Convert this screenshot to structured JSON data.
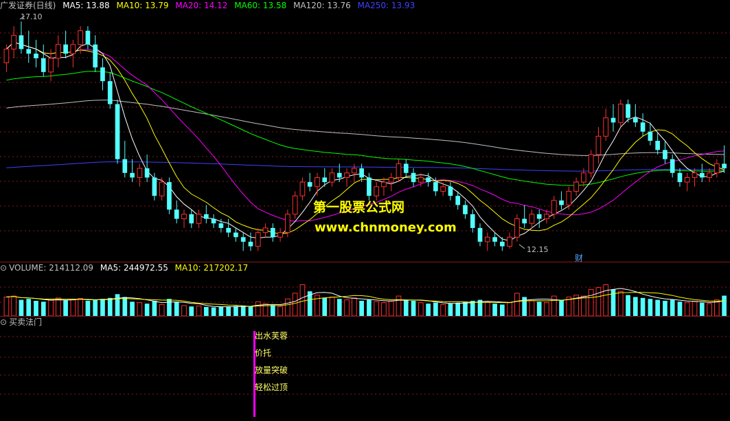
{
  "header": {
    "title": "广发证券(日线)",
    "ma5": "MA5: 13.88",
    "ma10": "MA10: 13.79",
    "ma20": "MA20: 14.12",
    "ma60": "MA60: 13.58",
    "ma120": "MA120: 13.76",
    "ma250": "MA250: 13.93"
  },
  "volume_header": {
    "label": "VOLUME: 214112.09",
    "ma5": "MA5: 244972.55",
    "ma10": "MA10: 217202.17"
  },
  "indicator_header": {
    "label": "买卖法门"
  },
  "annotations": {
    "high": "17.10",
    "low": "12.15",
    "finance": "财"
  },
  "watermark": {
    "line1": "第一股票公式网",
    "line2": "www.chnmoney.com"
  },
  "signals": [
    "出水芙蓉",
    "价托",
    "放量突破",
    "轻松过顶"
  ],
  "colors": {
    "up": "#ff3030",
    "down": "#54ffff",
    "ma5": "#ffffff",
    "ma10": "#ffff00",
    "ma20": "#ff00ff",
    "ma60": "#00ff00",
    "ma120": "#c0c0c0",
    "ma250": "#4040ff",
    "signal_bar": "#ff00ff"
  },
  "chart_data": {
    "type": "candlestick",
    "price_range": [
      12.0,
      17.3
    ],
    "volume_range": [
      0,
      450000
    ],
    "candles": [
      [
        16.2,
        16.6,
        16.0,
        16.5,
        200000
      ],
      [
        16.5,
        17.0,
        16.3,
        16.8,
        210000
      ],
      [
        16.8,
        17.1,
        16.4,
        16.5,
        170000
      ],
      [
        16.5,
        16.9,
        16.2,
        16.4,
        180000
      ],
      [
        16.4,
        16.7,
        16.1,
        16.3,
        160000
      ],
      [
        16.3,
        16.6,
        15.9,
        16.0,
        150000
      ],
      [
        16.0,
        16.5,
        15.8,
        16.3,
        170000
      ],
      [
        16.3,
        16.8,
        16.1,
        16.6,
        190000
      ],
      [
        16.6,
        16.9,
        16.3,
        16.4,
        165000
      ],
      [
        16.4,
        16.7,
        16.1,
        16.6,
        175000
      ],
      [
        16.6,
        17.0,
        16.4,
        16.9,
        185000
      ],
      [
        16.9,
        17.0,
        16.5,
        16.6,
        160000
      ],
      [
        16.6,
        16.8,
        16.0,
        16.1,
        170000
      ],
      [
        16.1,
        16.3,
        15.6,
        15.8,
        180000
      ],
      [
        15.8,
        16.0,
        15.2,
        15.3,
        190000
      ],
      [
        15.3,
        15.4,
        14.0,
        14.1,
        230000
      ],
      [
        14.1,
        14.5,
        13.7,
        13.8,
        200000
      ],
      [
        13.8,
        14.1,
        13.6,
        13.7,
        150000
      ],
      [
        13.7,
        14.0,
        13.5,
        13.9,
        140000
      ],
      [
        13.9,
        14.2,
        13.6,
        13.7,
        130000
      ],
      [
        13.7,
        13.8,
        13.2,
        13.3,
        160000
      ],
      [
        13.3,
        13.7,
        13.2,
        13.6,
        120000
      ],
      [
        13.6,
        13.7,
        12.9,
        13.0,
        180000
      ],
      [
        13.0,
        13.2,
        12.7,
        12.8,
        150000
      ],
      [
        12.8,
        13.0,
        12.6,
        12.9,
        110000
      ],
      [
        12.9,
        13.0,
        12.6,
        12.7,
        100000
      ],
      [
        12.7,
        13.0,
        12.6,
        12.9,
        105000
      ],
      [
        12.9,
        13.1,
        12.7,
        12.8,
        95000
      ],
      [
        12.8,
        12.9,
        12.6,
        12.7,
        90000
      ],
      [
        12.7,
        12.8,
        12.5,
        12.6,
        95000
      ],
      [
        12.6,
        12.8,
        12.4,
        12.5,
        100000
      ],
      [
        12.5,
        12.6,
        12.3,
        12.4,
        105000
      ],
      [
        12.4,
        12.5,
        12.1,
        12.3,
        110000
      ],
      [
        12.3,
        12.5,
        12.1,
        12.2,
        100000
      ],
      [
        12.2,
        12.6,
        12.1,
        12.5,
        150000
      ],
      [
        12.5,
        12.7,
        12.4,
        12.6,
        130000
      ],
      [
        12.6,
        12.7,
        12.3,
        12.4,
        115000
      ],
      [
        12.4,
        12.6,
        12.3,
        12.5,
        100000
      ],
      [
        12.5,
        13.0,
        12.4,
        12.9,
        180000
      ],
      [
        12.9,
        13.4,
        12.8,
        13.3,
        240000
      ],
      [
        13.3,
        13.7,
        13.2,
        13.6,
        330000
      ],
      [
        13.6,
        13.8,
        13.4,
        13.5,
        260000
      ],
      [
        13.5,
        13.8,
        13.3,
        13.7,
        220000
      ],
      [
        13.7,
        13.9,
        13.5,
        13.6,
        190000
      ],
      [
        13.6,
        13.9,
        13.5,
        13.8,
        200000
      ],
      [
        13.8,
        14.0,
        13.6,
        13.7,
        180000
      ],
      [
        13.7,
        13.9,
        13.5,
        13.8,
        170000
      ],
      [
        13.8,
        14.0,
        13.6,
        13.9,
        190000
      ],
      [
        13.9,
        14.0,
        13.6,
        13.7,
        160000
      ],
      [
        13.7,
        13.8,
        13.2,
        13.3,
        170000
      ],
      [
        13.3,
        13.6,
        13.2,
        13.5,
        150000
      ],
      [
        13.5,
        13.7,
        13.3,
        13.6,
        140000
      ],
      [
        13.6,
        13.8,
        13.4,
        13.7,
        160000
      ],
      [
        13.7,
        14.1,
        13.6,
        14.0,
        210000
      ],
      [
        14.0,
        14.1,
        13.7,
        13.8,
        170000
      ],
      [
        13.8,
        13.9,
        13.5,
        13.6,
        160000
      ],
      [
        13.6,
        13.8,
        13.5,
        13.7,
        140000
      ],
      [
        13.7,
        13.8,
        13.5,
        13.6,
        130000
      ],
      [
        13.6,
        13.7,
        13.3,
        13.4,
        140000
      ],
      [
        13.4,
        13.6,
        13.3,
        13.5,
        120000
      ],
      [
        13.5,
        13.6,
        13.2,
        13.3,
        130000
      ],
      [
        13.3,
        13.4,
        13.0,
        13.1,
        140000
      ],
      [
        13.1,
        13.2,
        12.8,
        12.9,
        150000
      ],
      [
        12.9,
        13.0,
        12.5,
        12.6,
        160000
      ],
      [
        12.6,
        12.7,
        12.2,
        12.3,
        170000
      ],
      [
        12.3,
        12.5,
        12.1,
        12.4,
        150000
      ],
      [
        12.4,
        12.5,
        12.2,
        12.3,
        130000
      ],
      [
        12.3,
        12.4,
        12.1,
        12.2,
        120000
      ],
      [
        12.2,
        12.5,
        12.15,
        12.4,
        140000
      ],
      [
        12.4,
        12.9,
        12.3,
        12.8,
        240000
      ],
      [
        12.8,
        13.1,
        12.6,
        12.7,
        200000
      ],
      [
        12.7,
        13.0,
        12.6,
        12.9,
        160000
      ],
      [
        12.9,
        13.0,
        12.6,
        12.8,
        150000
      ],
      [
        12.8,
        13.0,
        12.7,
        12.9,
        140000
      ],
      [
        12.9,
        13.3,
        12.8,
        13.2,
        210000
      ],
      [
        13.2,
        13.4,
        13.0,
        13.1,
        170000
      ],
      [
        13.1,
        13.5,
        13.0,
        13.4,
        200000
      ],
      [
        13.4,
        13.7,
        13.3,
        13.6,
        220000
      ],
      [
        13.6,
        13.9,
        13.5,
        13.8,
        210000
      ],
      [
        13.8,
        14.3,
        13.7,
        14.2,
        280000
      ],
      [
        14.2,
        14.8,
        14.0,
        14.6,
        300000
      ],
      [
        14.6,
        15.2,
        14.5,
        15.0,
        330000
      ],
      [
        15.0,
        15.3,
        14.7,
        14.9,
        280000
      ],
      [
        14.9,
        15.4,
        14.8,
        15.3,
        260000
      ],
      [
        15.3,
        15.4,
        14.9,
        15.0,
        220000
      ],
      [
        15.0,
        15.3,
        14.8,
        14.9,
        200000
      ],
      [
        14.9,
        15.1,
        14.6,
        14.7,
        190000
      ],
      [
        14.7,
        14.9,
        14.4,
        14.5,
        180000
      ],
      [
        14.5,
        14.7,
        14.2,
        14.3,
        170000
      ],
      [
        14.3,
        14.5,
        14.0,
        14.1,
        160000
      ],
      [
        14.1,
        14.2,
        13.7,
        13.8,
        170000
      ],
      [
        13.8,
        13.9,
        13.5,
        13.6,
        150000
      ],
      [
        13.6,
        13.8,
        13.4,
        13.7,
        140000
      ],
      [
        13.7,
        13.9,
        13.5,
        13.8,
        150000
      ],
      [
        13.8,
        14.0,
        13.6,
        13.7,
        140000
      ],
      [
        13.7,
        13.9,
        13.6,
        13.8,
        130000
      ],
      [
        13.8,
        14.1,
        13.7,
        14.0,
        170000
      ],
      [
        14.0,
        14.4,
        13.8,
        13.9,
        214112
      ]
    ]
  }
}
